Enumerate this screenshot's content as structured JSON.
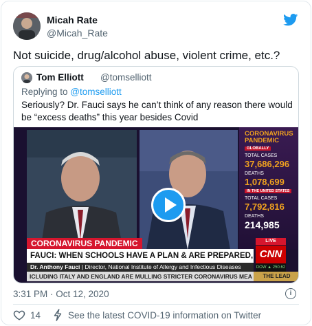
{
  "author": {
    "name": "Micah Rate",
    "handle": "@Micah_Rate"
  },
  "tweet": {
    "text": "Not suicide, drug/alcohol abuse, violent crime, etc.?"
  },
  "quoted": {
    "name": "Tom Elliott",
    "handle": "@tomselliott",
    "reply_prefix": "Replying to ",
    "reply_to": "@tomselliott",
    "text": "Seriously? Dr. Fauci says he can’t think of any reason there would be “excess deaths” this year besides Covid"
  },
  "video": {
    "stats_title_1": "CORONAVIRUS",
    "stats_title_2": "PANDEMIC",
    "globally_tag": "GLOBALLY",
    "global_cases_label": "TOTAL CASES",
    "global_cases_value": "37,686,296",
    "global_deaths_label": "DEATHS",
    "global_deaths_value": "1,078,699",
    "us_tag": "IN THE UNITED STATES",
    "us_cases_label": "TOTAL CASES",
    "us_cases_value": "7,792,816",
    "us_deaths_label": "DEATHS",
    "us_deaths_value": "214,985",
    "banner_topic": "CORONAVIRUS PANDEMIC",
    "headline": "FAUCI: WHEN SCHOOLS HAVE A PLAN & ARE PREPARED, IT CAN WORK",
    "guest_name": "Dr. Anthony Fauci",
    "guest_title": "Director, National Institute of Allergy and Infectious Diseases",
    "ticker": "ICLUDING ITALY AND ENGLAND ARE MULLING STRICTER CORONAVIRUS MEA",
    "live": "LIVE",
    "network": "CNN",
    "dow": "DOW ▲ 250.62",
    "show": "THE LEAD"
  },
  "footer": {
    "timestamp": "3:31 PM · Oct 12, 2020",
    "like_count": "14",
    "covid_link": "See the latest COVID-19 information on Twitter"
  },
  "colors": {
    "twitter_blue": "#1d9bf0",
    "cnn_red": "#cc0000",
    "stats_orange": "#f0a21f"
  }
}
